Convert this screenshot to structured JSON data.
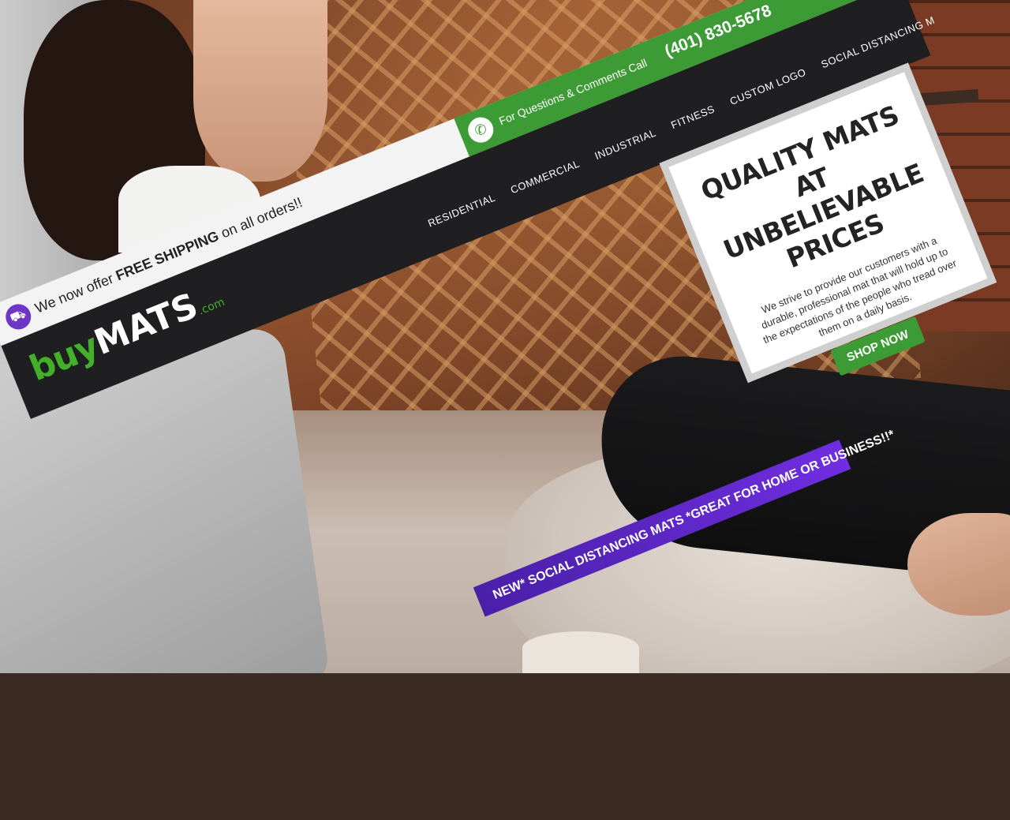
{
  "shipping_bar": {
    "prefix": "We now offer ",
    "highlight": "FREE SHIPPING",
    "suffix": " on all orders!!"
  },
  "contact_bar": {
    "label": "For Questions & Comments Call",
    "phone": "(401) 830-5678"
  },
  "logo": {
    "buy": "buy",
    "mats": "MATS",
    "com": ".com"
  },
  "nav": {
    "items": [
      {
        "label": "RESIDENTIAL"
      },
      {
        "label": "COMMERCIAL"
      },
      {
        "label": "INDUSTRIAL"
      },
      {
        "label": "FITNESS"
      },
      {
        "label": "CUSTOM LOGO"
      },
      {
        "label": "SOCIAL DISTANCING M"
      }
    ]
  },
  "hero": {
    "title_line1": "QUALITY MATS AT",
    "title_line2": "UNBELIEVABLE",
    "title_line3": "PRICES",
    "description": "We strive to provide our customers with a durable, professional mat that will hold up to the expectations of the people who tread over them on a daily basis.",
    "button_label": "SHOP NOW"
  },
  "promo_banner": {
    "text": "NEW* SOCIAL DISTANCING MATS *GREAT FOR HOME OR BUSINESS!!*"
  },
  "colors": {
    "brand_green": "#3d9b35",
    "nav_dark": "#1f1f22",
    "promo_purple": "#6f2ee0",
    "icon_purple": "#6d36c7"
  },
  "icons": {
    "shipping": "truck-icon",
    "phone": "phone-icon"
  }
}
